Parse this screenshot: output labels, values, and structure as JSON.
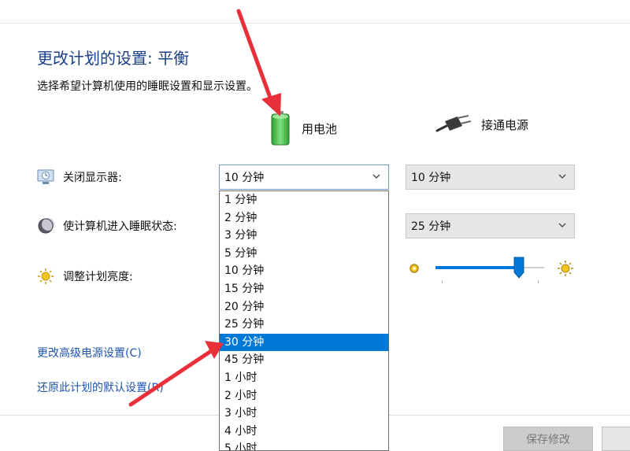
{
  "page": {
    "title": "更改计划的设置: 平衡",
    "subtitle": "选择希望计算机使用的睡眠设置和显示设置。"
  },
  "columns": {
    "battery_label": "用电池",
    "plugged_label": "接通电源"
  },
  "rows": {
    "display_off_label": "关闭显示器:",
    "sleep_label": "使计算机进入睡眠状态:",
    "brightness_label": "调整计划亮度:"
  },
  "display_off": {
    "battery_value": "10 分钟",
    "plugged_value": "10 分钟"
  },
  "sleep": {
    "plugged_value": "25 分钟"
  },
  "dropdown": {
    "options": [
      "1 分钟",
      "2 分钟",
      "3 分钟",
      "5 分钟",
      "10 分钟",
      "15 分钟",
      "20 分钟",
      "25 分钟",
      "30 分钟",
      "45 分钟",
      "1 小时",
      "2 小时",
      "3 小时",
      "4 小时",
      "5 小时"
    ],
    "highlighted_index": 8
  },
  "brightness": {
    "plugged_level": 0.77
  },
  "links": {
    "advanced": "更改高级电源设置(C)",
    "restore": "还原此计划的默认设置(R)"
  },
  "buttons": {
    "save": "保存修改"
  },
  "colors": {
    "title": "#1a3f8a",
    "link": "#1f55b3",
    "highlight": "#0078d7",
    "annotation_arrow": "#e8303a"
  }
}
